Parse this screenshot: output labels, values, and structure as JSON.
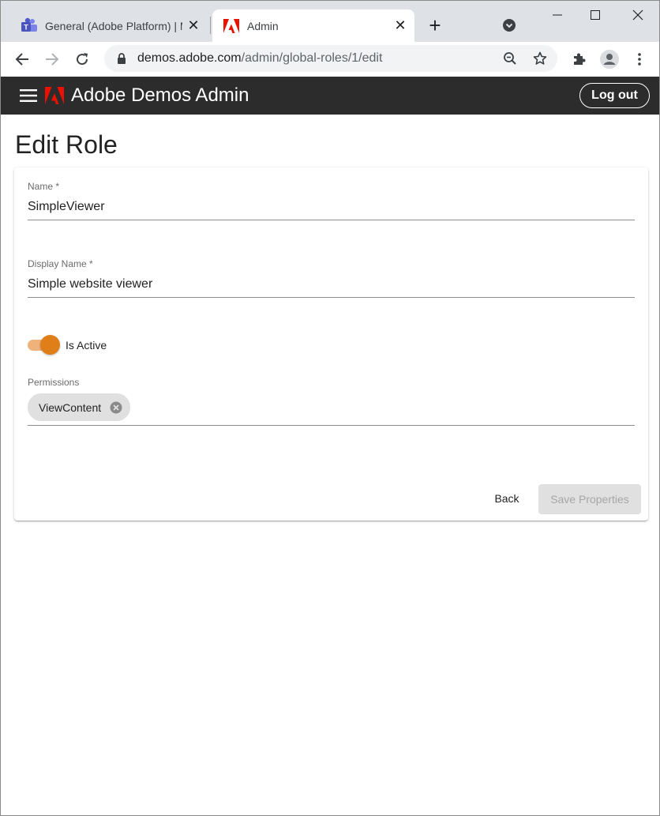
{
  "browser": {
    "tabs": [
      {
        "title": "General (Adobe Platform) | M",
        "active": false,
        "icon": "teams-icon"
      },
      {
        "title": "Admin",
        "active": true,
        "icon": "adobe-icon"
      }
    ],
    "address": {
      "host": "demos.adobe.com",
      "path": "/admin/global-roles/1/edit"
    }
  },
  "app": {
    "title": "Adobe Demos Admin",
    "logout_label": "Log out",
    "brand_color": "#eb1000",
    "header_bg": "#2c2c2c"
  },
  "page": {
    "title": "Edit Role"
  },
  "form": {
    "name": {
      "label": "Name *",
      "value": "SimpleViewer"
    },
    "display_name": {
      "label": "Display Name *",
      "value": "Simple website viewer"
    },
    "is_active": {
      "label": "Is Active",
      "checked": true,
      "accent": "#e07f1a"
    },
    "permissions": {
      "label": "Permissions",
      "chips": [
        {
          "label": "ViewContent"
        }
      ]
    },
    "back_label": "Back",
    "save_label": "Save Properties",
    "save_disabled": true
  }
}
